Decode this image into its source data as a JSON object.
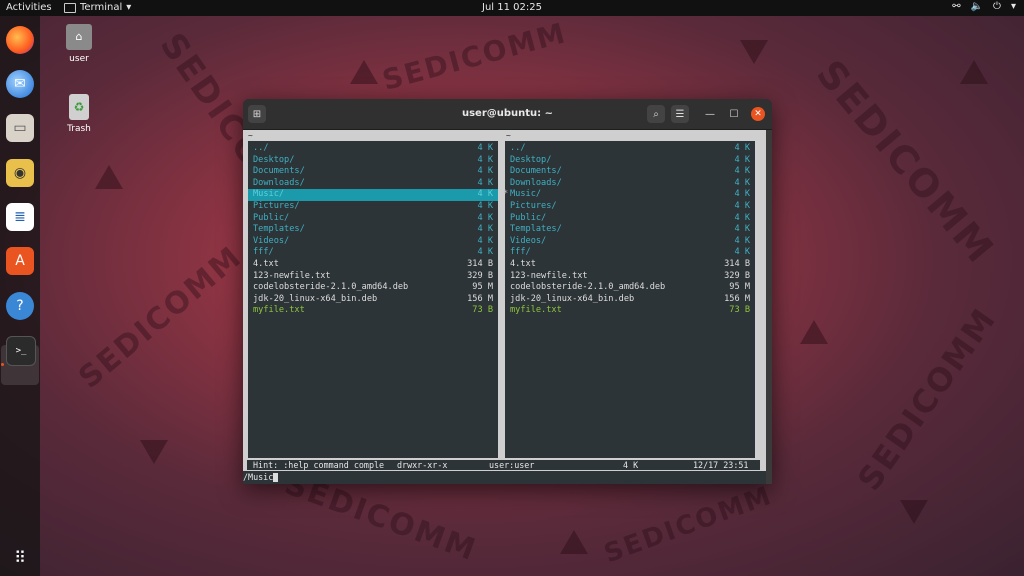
{
  "topbar": {
    "activities": "Activities",
    "app_name": "Terminal",
    "clock": "Jul 11  02:25"
  },
  "desktop": {
    "home_label": "user",
    "trash_label": "Trash"
  },
  "dock": {
    "items": [
      "firefox-icon",
      "thunderbird-icon",
      "files-icon",
      "rhythmbox-icon",
      "writer-icon",
      "software-icon",
      "help-icon",
      "terminal-icon"
    ],
    "grid_icon": "show-apps-icon"
  },
  "wallpaper": {
    "text": "SEDICOMM"
  },
  "window": {
    "title": "user@ubuntu: ~"
  },
  "file_manager": {
    "left": {
      "path": "~",
      "rows": [
        {
          "name": "../",
          "size": "4 K",
          "type": "dir"
        },
        {
          "name": "Desktop/",
          "size": "4 K",
          "type": "dir"
        },
        {
          "name": "Documents/",
          "size": "4 K",
          "type": "dir"
        },
        {
          "name": "Downloads/",
          "size": "4 K",
          "type": "dir"
        },
        {
          "name": "Music/",
          "size": "4 K",
          "type": "dir",
          "selected": true
        },
        {
          "name": "Pictures/",
          "size": "4 K",
          "type": "dir"
        },
        {
          "name": "Public/",
          "size": "4 K",
          "type": "dir"
        },
        {
          "name": "Templates/",
          "size": "4 K",
          "type": "dir"
        },
        {
          "name": "Videos/",
          "size": "4 K",
          "type": "dir"
        },
        {
          "name": "fff/",
          "size": "4 K",
          "type": "dir"
        },
        {
          "name": "4.txt",
          "size": "314 B",
          "type": "file"
        },
        {
          "name": "123-newfile.txt",
          "size": "329 B",
          "type": "file"
        },
        {
          "name": "codelobsteride-2.1.0_amd64.deb",
          "size": "95 M",
          "type": "file"
        },
        {
          "name": "jdk-20_linux-x64_bin.deb",
          "size": "156 M",
          "type": "file"
        },
        {
          "name": "myfile.txt",
          "size": "73 B",
          "type": "exe"
        }
      ]
    },
    "right": {
      "path": "~",
      "rows": [
        {
          "name": "../",
          "size": "4 K",
          "type": "dir"
        },
        {
          "name": "Desktop/",
          "size": "4 K",
          "type": "dir"
        },
        {
          "name": "Documents/",
          "size": "4 K",
          "type": "dir"
        },
        {
          "name": "Downloads/",
          "size": "4 K",
          "type": "dir"
        },
        {
          "name": "Music/",
          "size": "4 K",
          "type": "dir",
          "marked": true
        },
        {
          "name": "Pictures/",
          "size": "4 K",
          "type": "dir"
        },
        {
          "name": "Public/",
          "size": "4 K",
          "type": "dir"
        },
        {
          "name": "Templates/",
          "size": "4 K",
          "type": "dir"
        },
        {
          "name": "Videos/",
          "size": "4 K",
          "type": "dir"
        },
        {
          "name": "fff/",
          "size": "4 K",
          "type": "dir"
        },
        {
          "name": "4.txt",
          "size": "314 B",
          "type": "file"
        },
        {
          "name": "123-newfile.txt",
          "size": "329 B",
          "type": "file"
        },
        {
          "name": "codelobsteride-2.1.0_amd64.deb",
          "size": "95 M",
          "type": "file"
        },
        {
          "name": "jdk-20_linux-x64_bin.deb",
          "size": "156 M",
          "type": "file"
        },
        {
          "name": "myfile.txt",
          "size": "73 B",
          "type": "exe"
        }
      ]
    },
    "status": {
      "hint": "Hint: :help command comple",
      "perms": "drwxr-xr-x",
      "owner": "user:user",
      "size": "4 K",
      "date": "12/17 23:51"
    },
    "command_line": "/Music"
  }
}
